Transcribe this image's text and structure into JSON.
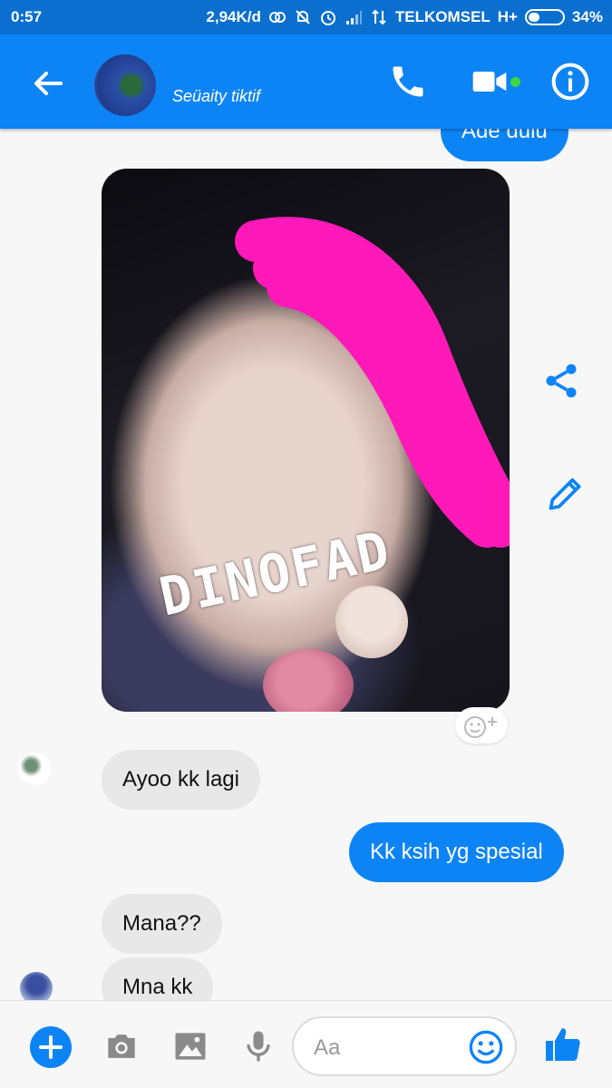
{
  "status_bar": {
    "time": "0:57",
    "data_rate": "2,94K/d",
    "carrier": "TELKOMSEL",
    "network": "H+",
    "battery": "34%",
    "battery_level": 0.34
  },
  "header": {
    "contact_name": "Seüaity tiktif",
    "icons": [
      "back-arrow-icon",
      "phone-icon",
      "video-camera-icon",
      "info-icon"
    ],
    "online_indicator_color": "#42d442"
  },
  "messages": [
    {
      "id": "m1",
      "direction": "outgoing",
      "text": "Ade dulu"
    },
    {
      "id": "m2",
      "direction": "outgoing",
      "type": "photo",
      "watermark": "DINOFAD"
    },
    {
      "id": "m3",
      "direction": "incoming",
      "text": "Ayoo kk lagi"
    },
    {
      "id": "m4",
      "direction": "outgoing",
      "text": "Kk ksih yg spesial"
    },
    {
      "id": "m5",
      "direction": "incoming",
      "text": "Mana??"
    },
    {
      "id": "m6",
      "direction": "incoming",
      "text": "Mna kk"
    }
  ],
  "photo_actions": [
    "share-icon",
    "edit-pencil-icon",
    "add-reaction-icon"
  ],
  "composer": {
    "placeholder": "Aa",
    "icons": [
      "plus-icon",
      "camera-icon",
      "gallery-icon",
      "microphone-icon",
      "emoji-icon",
      "thumbs-up-icon"
    ]
  },
  "colors": {
    "accent": "#0d84f6",
    "status_bar": "#0a6fcf",
    "incoming_bubble": "#e8e8e8",
    "outgoing_bubble": "#0d84f6",
    "scribble": "#ff19b8"
  }
}
